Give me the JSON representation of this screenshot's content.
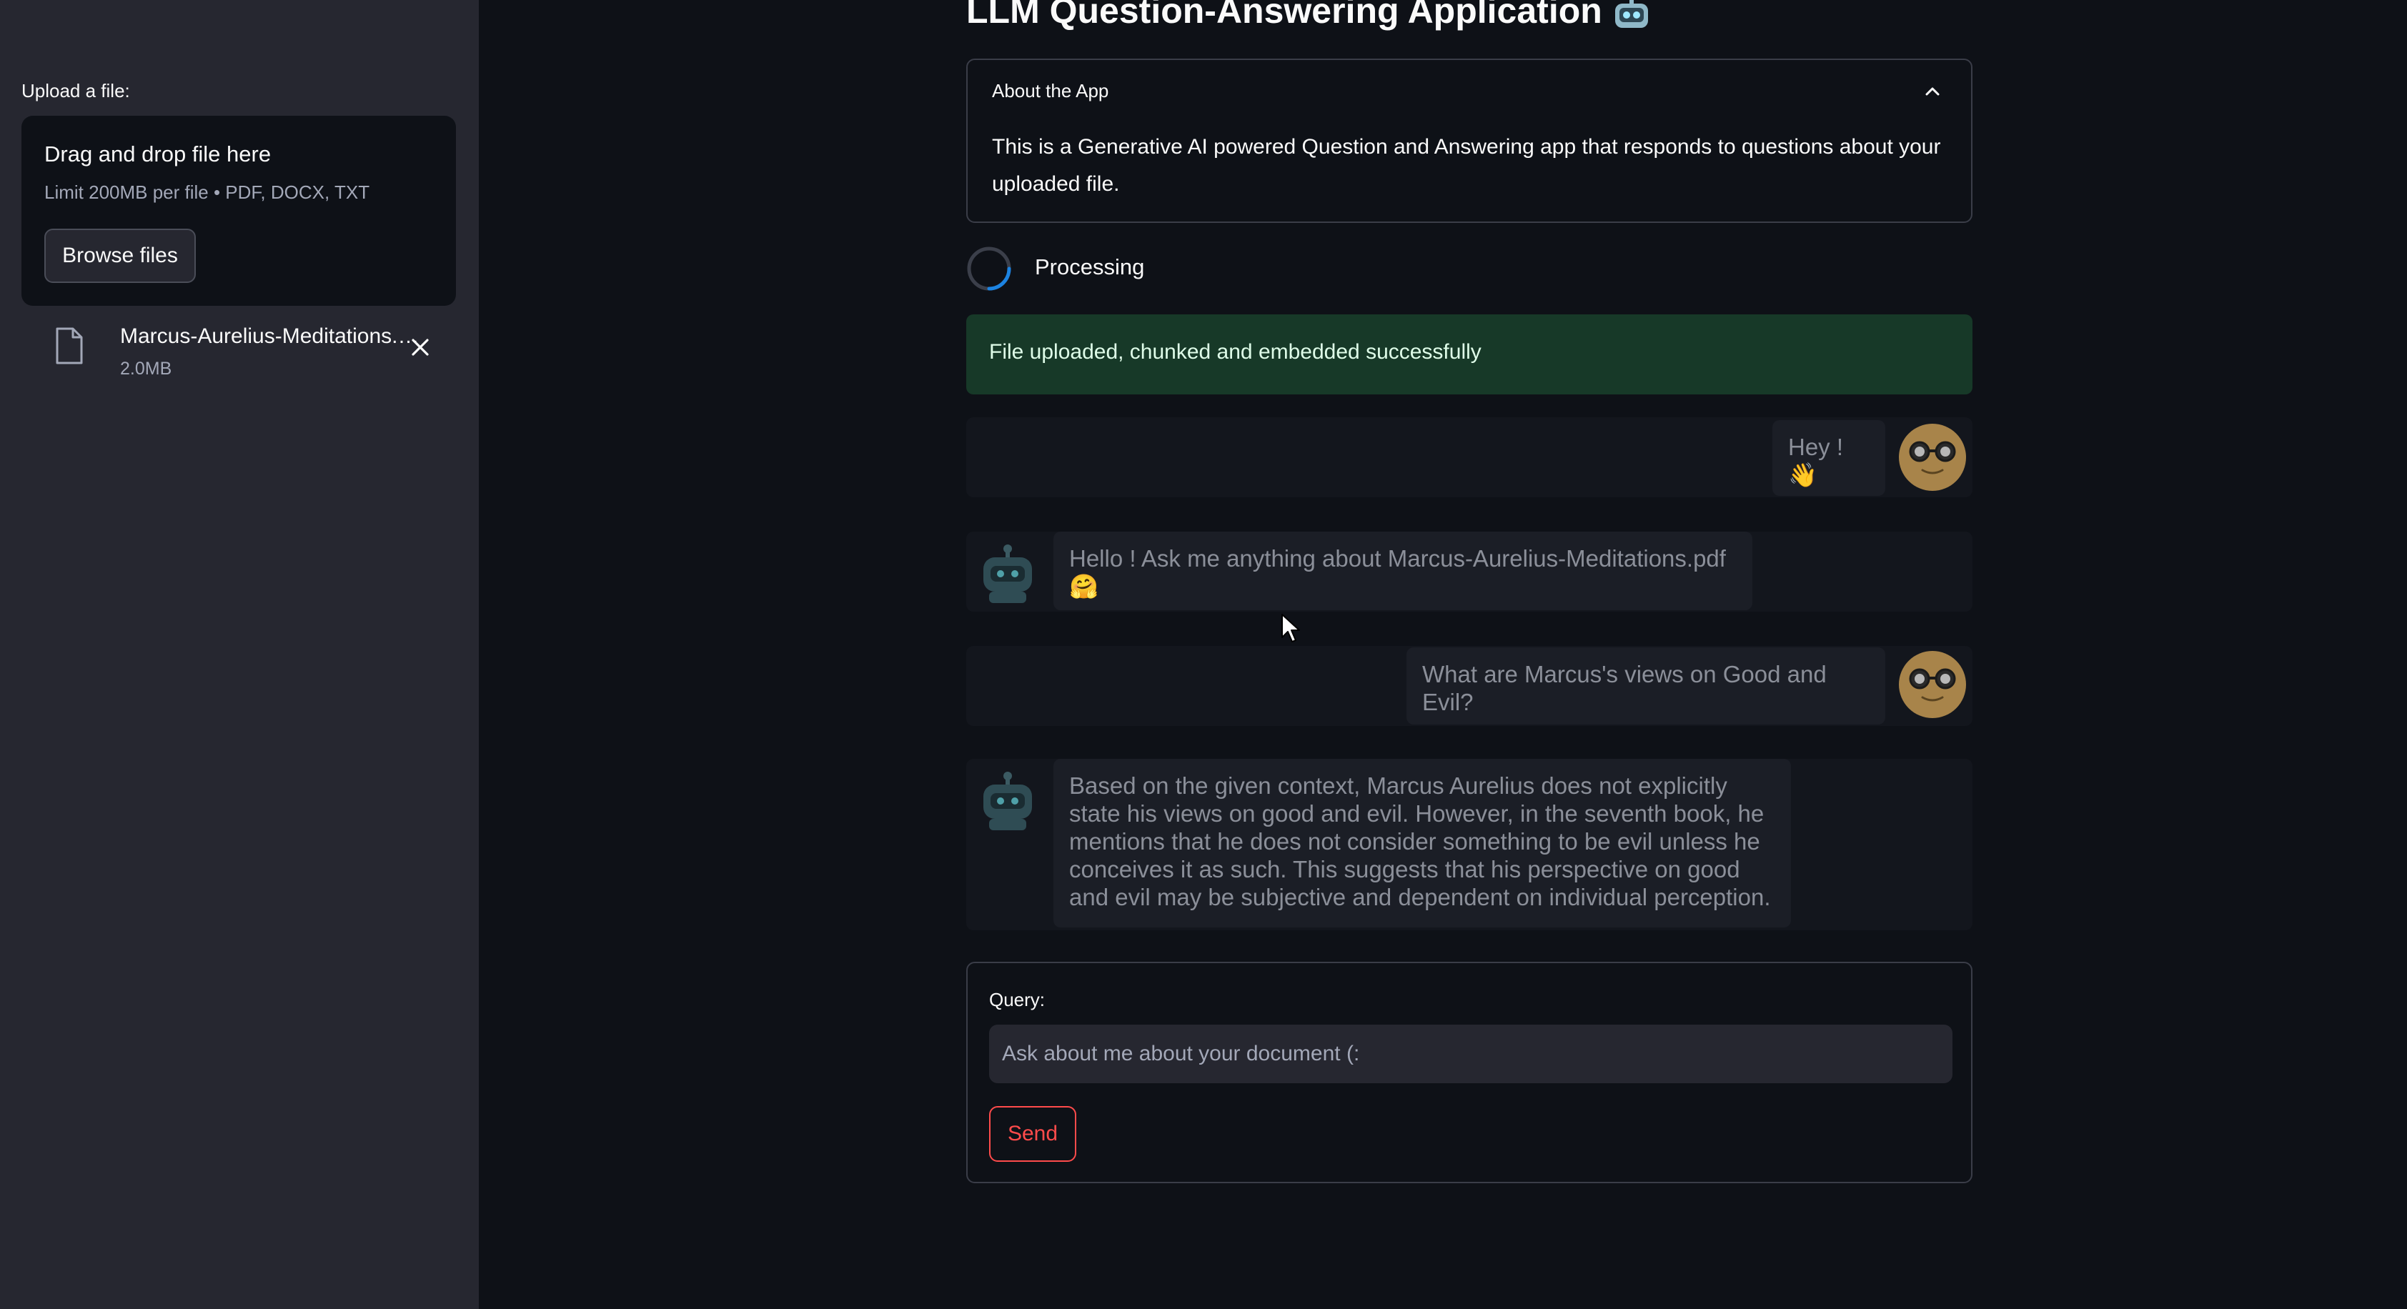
{
  "sidebar": {
    "upload_label": "Upload a file:",
    "dropzone_title": "Drag and drop file here",
    "dropzone_limit": "Limit 200MB per file • PDF, DOCX, TXT",
    "browse_label": "Browse files",
    "file": {
      "name": "Marcus-Aurelius-Meditations.pdf",
      "size": "2.0MB",
      "icon": "document-icon"
    }
  },
  "main": {
    "title": "LLM Question-Answering Application",
    "title_icon": "robot-icon",
    "about": {
      "title": "About the App",
      "body": "This is a Generative AI powered Question and Answering app that responds to questions about your uploaded file."
    },
    "status_text": "Processing",
    "success_text": "File uploaded, chunked and embedded successfully",
    "messages": [
      {
        "role": "user",
        "text": "Hey ! 👋"
      },
      {
        "role": "assistant",
        "text": "Hello ! Ask me anything about Marcus-Aurelius-Meditations.pdf 🤗"
      },
      {
        "role": "user",
        "text": "What are Marcus's views on Good and Evil?"
      },
      {
        "role": "assistant",
        "text": "Based on the given context, Marcus Aurelius does not explicitly state his views on good and evil. However, in the seventh book, he mentions that he does not consider something to be evil unless he conceives it as such. This suggests that his perspective on good and evil may be subjective and dependent on individual perception."
      }
    ],
    "query": {
      "label": "Query:",
      "value": "",
      "placeholder": "Ask about me about your document (:",
      "send_label": "Send"
    }
  },
  "colors": {
    "background": "#0e1117",
    "sidebar": "#262730",
    "success_bg": "#173928",
    "accent_red": "#ff4b4b",
    "spinner": "#1c83e1"
  }
}
